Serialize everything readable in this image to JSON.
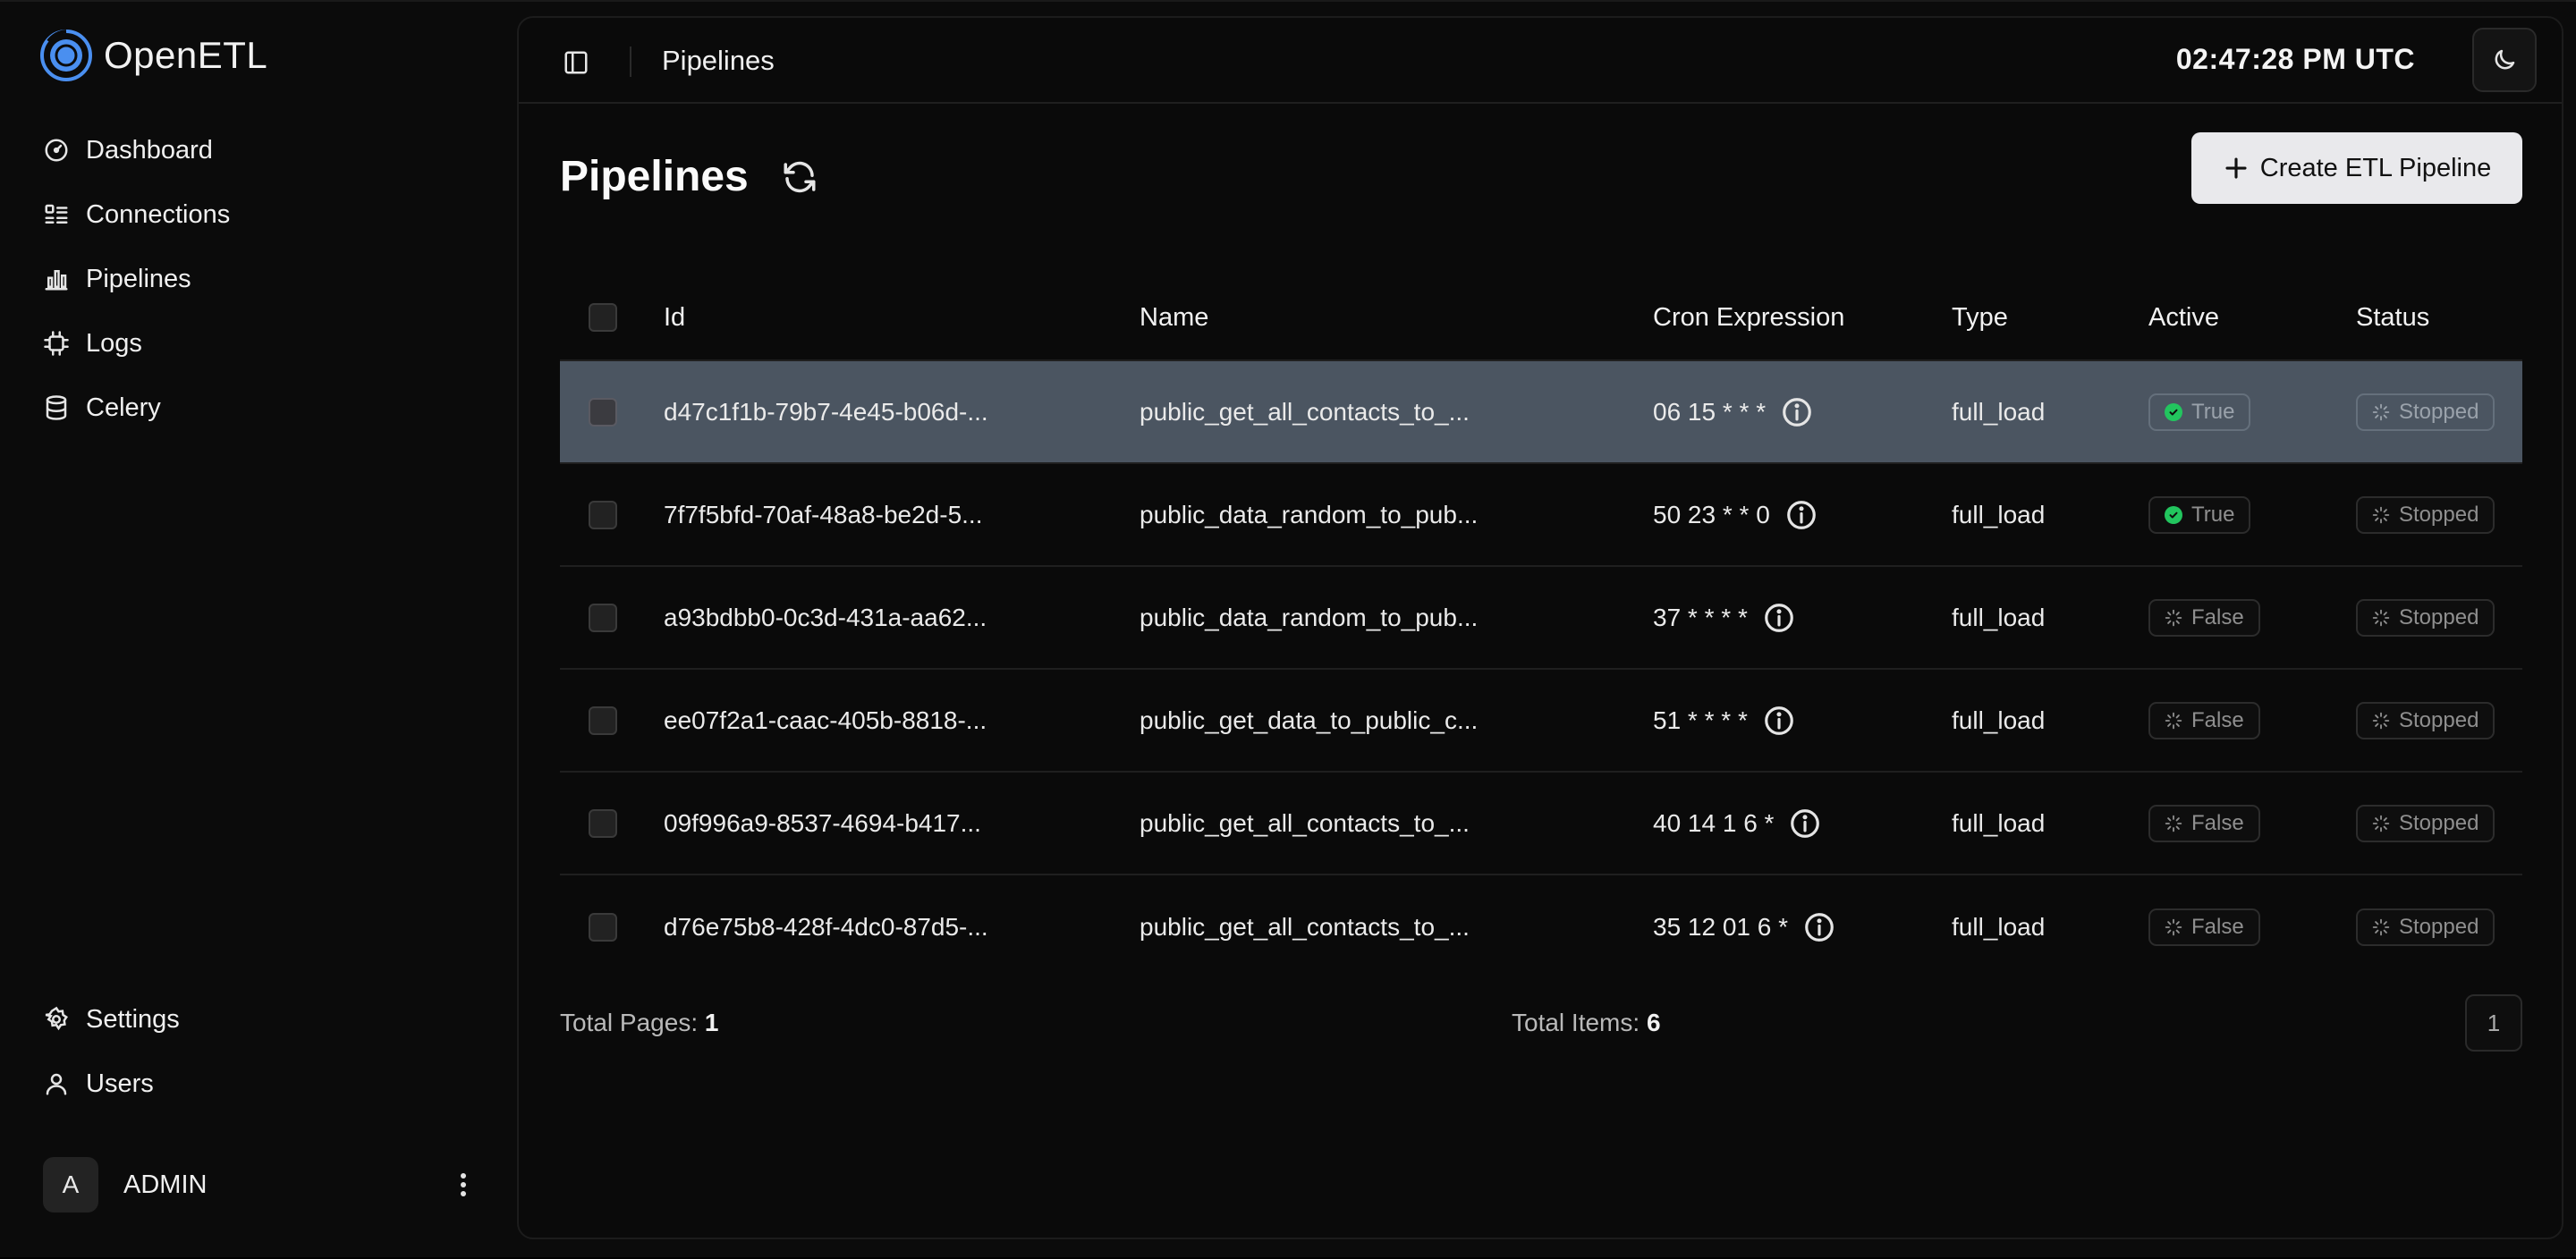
{
  "app": {
    "name": "OpenETL"
  },
  "sidebar": {
    "items": [
      {
        "label": "Dashboard",
        "icon": "dashboard-icon"
      },
      {
        "label": "Connections",
        "icon": "connections-icon"
      },
      {
        "label": "Pipelines",
        "icon": "pipelines-icon"
      },
      {
        "label": "Logs",
        "icon": "logs-icon"
      },
      {
        "label": "Celery",
        "icon": "database-icon"
      }
    ],
    "bottom_items": [
      {
        "label": "Settings",
        "icon": "gear-icon"
      },
      {
        "label": "Users",
        "icon": "user-icon"
      }
    ],
    "user": {
      "initial": "A",
      "name": "ADMIN"
    }
  },
  "topbar": {
    "title": "Pipelines",
    "clock": "02:47:28 PM UTC"
  },
  "page": {
    "title": "Pipelines",
    "create_button": "Create ETL Pipeline"
  },
  "table": {
    "columns": {
      "id": "Id",
      "name": "Name",
      "cron": "Cron Expression",
      "type": "Type",
      "active": "Active",
      "status": "Status"
    },
    "rows": [
      {
        "id": "d47c1f1b-79b7-4e45-b06d-...",
        "name": "public_get_all_contacts_to_...",
        "cron": "06 15 * * *",
        "type": "full_load",
        "active": "True",
        "status": "Stopped"
      },
      {
        "id": "7f7f5bfd-70af-48a8-be2d-5...",
        "name": "public_data_random_to_pub...",
        "cron": "50 23 * * 0",
        "type": "full_load",
        "active": "True",
        "status": "Stopped"
      },
      {
        "id": "a93bdbb0-0c3d-431a-aa62...",
        "name": "public_data_random_to_pub...",
        "cron": "37 * * * *",
        "type": "full_load",
        "active": "False",
        "status": "Stopped"
      },
      {
        "id": "ee07f2a1-caac-405b-8818-...",
        "name": "public_get_data_to_public_c...",
        "cron": "51 * * * *",
        "type": "full_load",
        "active": "False",
        "status": "Stopped"
      },
      {
        "id": "09f996a9-8537-4694-b417...",
        "name": "public_get_all_contacts_to_...",
        "cron": "40 14 1 6 *",
        "type": "full_load",
        "active": "False",
        "status": "Stopped"
      },
      {
        "id": "d76e75b8-428f-4dc0-87d5-...",
        "name": "public_get_all_contacts_to_...",
        "cron": "35 12 01 6 *",
        "type": "full_load",
        "active": "False",
        "status": "Stopped"
      }
    ]
  },
  "footer": {
    "total_pages_label": "Total Pages:",
    "total_pages": "1",
    "total_items_label": "Total Items:",
    "total_items": "6",
    "current_page": "1"
  },
  "colors": {
    "selected_row": "#4b5561",
    "active_green": "#22c55e",
    "logo_blue": "#3b82f6"
  }
}
